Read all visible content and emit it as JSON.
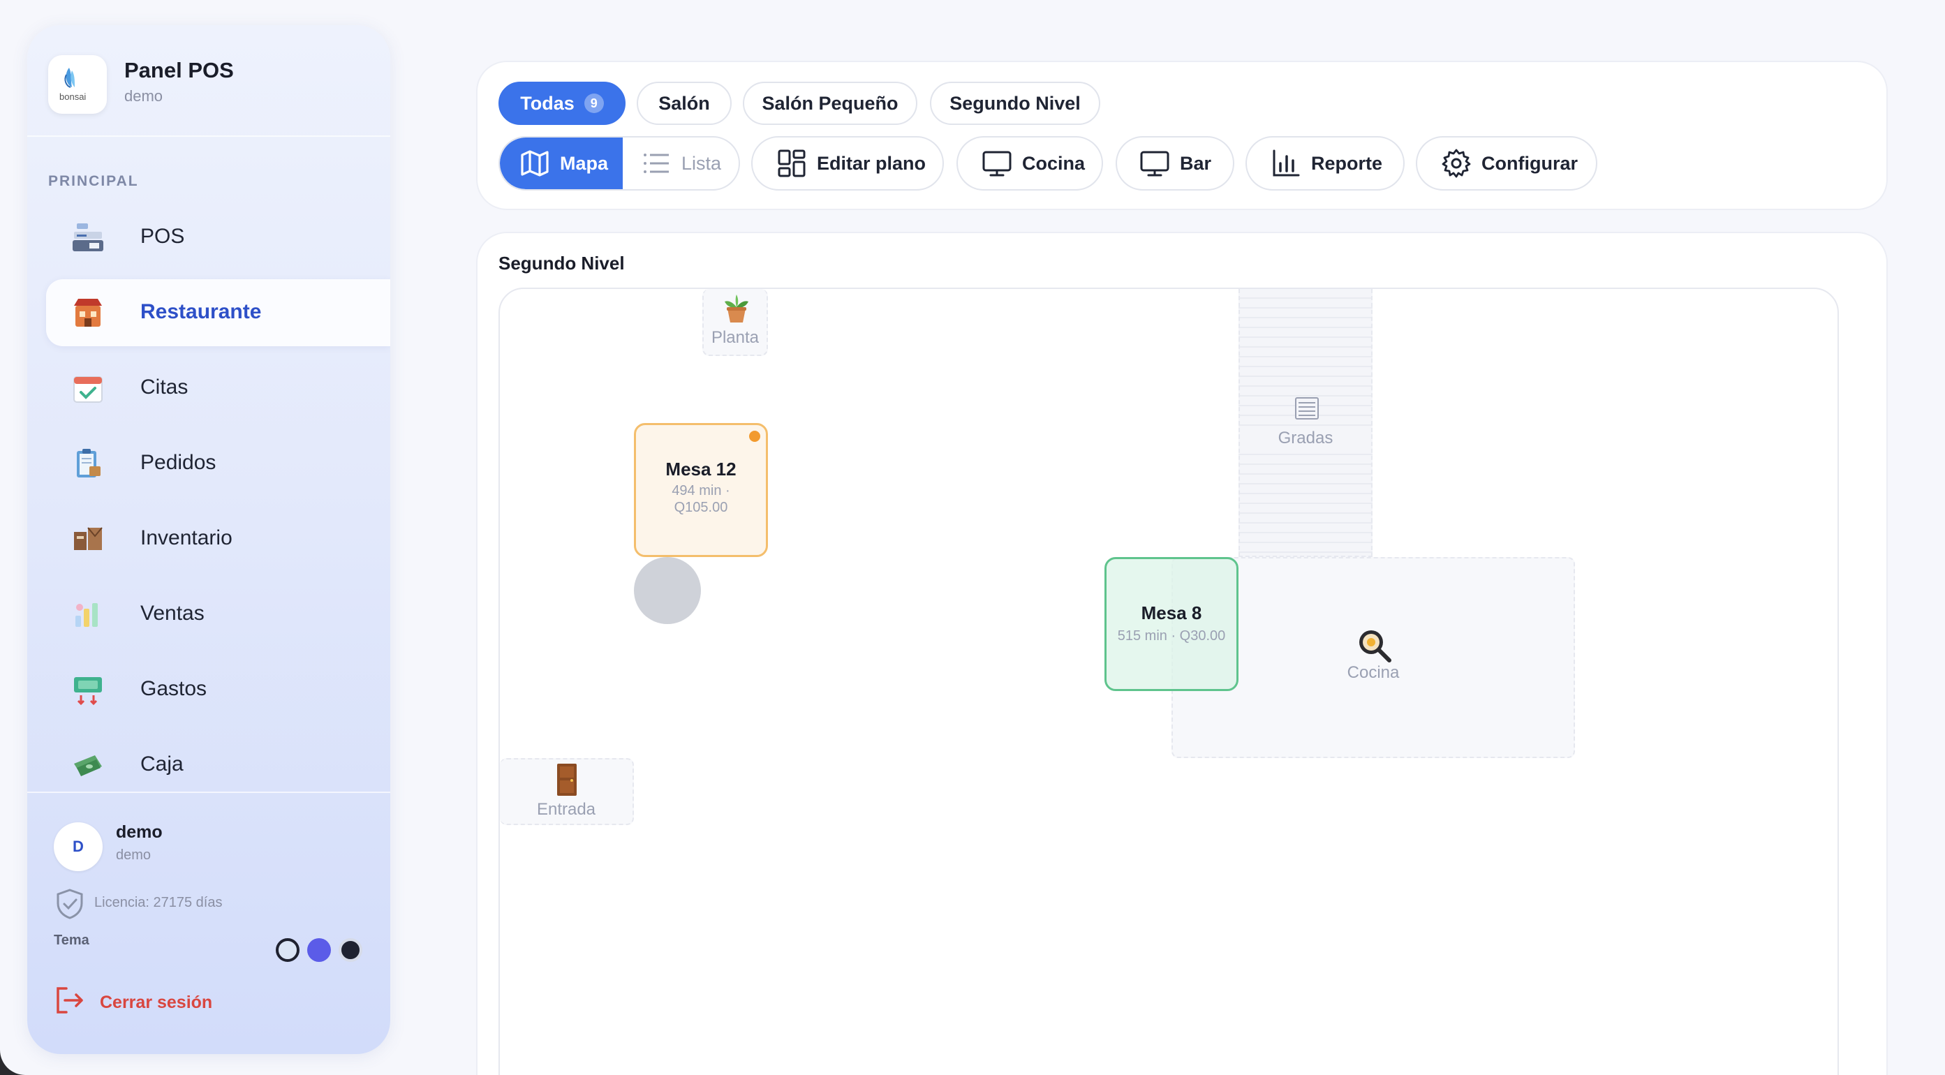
{
  "sidebar": {
    "brand": {
      "title": "Panel POS",
      "subtitle": "demo",
      "logo_text": "bonsai"
    },
    "section_label": "PRINCIPAL",
    "items": [
      {
        "label": "POS",
        "icon": "pos-register-icon"
      },
      {
        "label": "Restaurante",
        "icon": "restaurant-icon",
        "active": true
      },
      {
        "label": "Citas",
        "icon": "calendar-check-icon"
      },
      {
        "label": "Pedidos",
        "icon": "clipboard-orders-icon"
      },
      {
        "label": "Inventario",
        "icon": "inventory-boxes-icon"
      },
      {
        "label": "Ventas",
        "icon": "sales-chart-icon"
      },
      {
        "label": "Gastos",
        "icon": "expenses-icon"
      },
      {
        "label": "Caja",
        "icon": "cash-icon"
      }
    ],
    "user": {
      "initial": "D",
      "name": "demo",
      "role": "demo"
    },
    "license": "Licencia: 27175 días",
    "theme_label": "Tema",
    "theme_colors": [
      "#dbe5f5",
      "#5b5ce8",
      "#1f2230"
    ],
    "logout_label": "Cerrar sesión"
  },
  "filters": {
    "tabs": [
      {
        "label": "Todas",
        "count": "9",
        "active": true
      },
      {
        "label": "Salón"
      },
      {
        "label": "Salón Pequeño"
      },
      {
        "label": "Segundo Nivel"
      }
    ]
  },
  "toolbar": {
    "view_map": "Mapa",
    "view_list": "Lista",
    "edit_plan": "Editar plano",
    "kitchen": "Cocina",
    "bar": "Bar",
    "report": "Reporte",
    "settings": "Configurar"
  },
  "map": {
    "title": "Segundo Nivel",
    "decor": {
      "plant": "Planta",
      "stairs": "Gradas",
      "kitchen": "Cocina",
      "entrance": "Entrada"
    },
    "tables": [
      {
        "name": "Mesa 12",
        "meta": "494 min · Q105.00",
        "status": "occupied"
      },
      {
        "name": "Mesa 8",
        "meta": "515 min · Q30.00",
        "status": "free"
      }
    ]
  },
  "colors": {
    "accent": "#3b73ea",
    "active_nav_text": "#2e50c8",
    "logout": "#d9463f",
    "occupied_border": "#f4be6c",
    "free_border": "#5fc48d"
  }
}
